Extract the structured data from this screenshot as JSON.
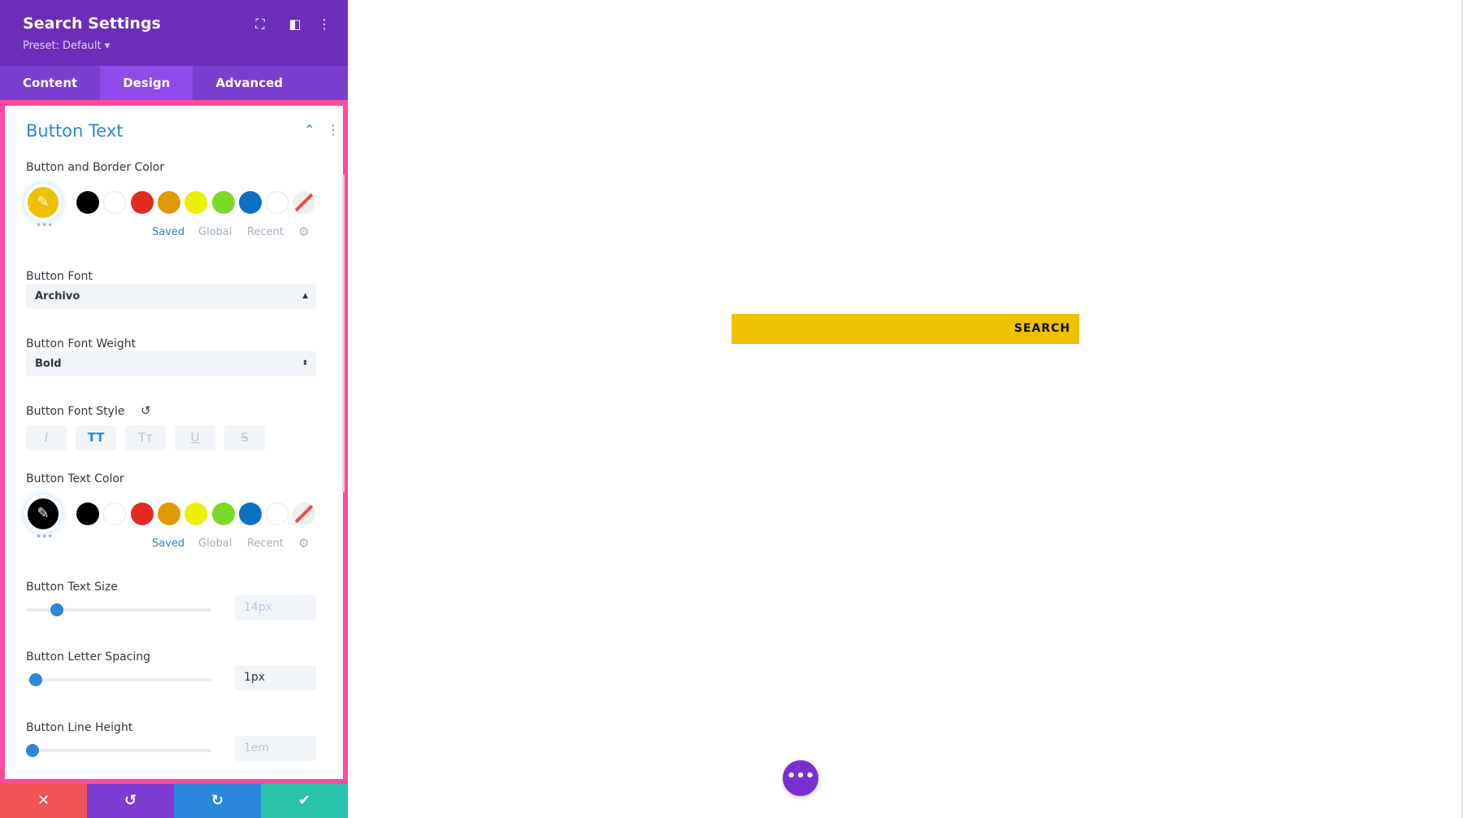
{
  "header": {
    "title": "Search Settings",
    "preset": "Preset: Default ▾",
    "icons": [
      "focus-icon",
      "split-view-icon",
      "more-icon"
    ]
  },
  "tabs": [
    {
      "label": "Content"
    },
    {
      "label": "Design",
      "active": true
    },
    {
      "label": "Advanced"
    }
  ],
  "section": {
    "title": "Button Text"
  },
  "palette": [
    "#000000",
    "#ffffff",
    "#e02b20",
    "#e09900",
    "#edf000",
    "#7cda24",
    "#0c71c3",
    "#ffffff",
    "none"
  ],
  "color_tabs": {
    "saved": "Saved",
    "global": "Global",
    "recent": "Recent"
  },
  "button_color": {
    "label": "Button and Border Color",
    "value": "#eec100"
  },
  "button_font": {
    "label": "Button Font",
    "value": "Archivo"
  },
  "font_weight": {
    "label": "Button Font Weight",
    "value": "Bold"
  },
  "font_style": {
    "label": "Button Font Style",
    "buttons": [
      "I",
      "TT",
      "Tт",
      "U",
      "S"
    ],
    "active": "TT"
  },
  "text_color": {
    "label": "Button Text Color",
    "value": "#000000"
  },
  "text_size": {
    "label": "Button Text Size",
    "value": "14px",
    "slider_fraction": 0.14
  },
  "letter_spacing": {
    "label": "Button Letter Spacing",
    "value": "1px",
    "slider_fraction": 0.02
  },
  "line_height": {
    "label": "Button Line Height",
    "value": "1em",
    "slider_fraction": 0.0
  },
  "footer": {
    "colors": [
      "#ef5555",
      "#7e3bd0",
      "#2b87da",
      "#29c4a9"
    ]
  },
  "preview": {
    "search_label": "SEARCH",
    "button_color": "#eec100"
  }
}
